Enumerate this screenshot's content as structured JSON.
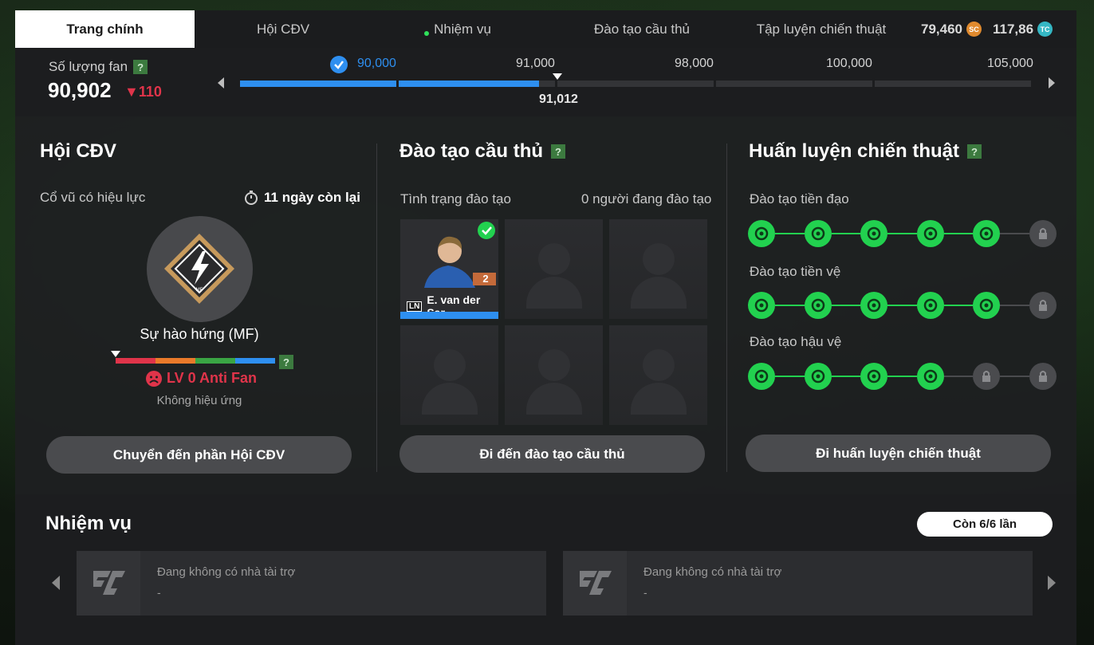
{
  "tabs": [
    {
      "label": "Trang chính",
      "active": true
    },
    {
      "label": "Hội CĐV",
      "active": false
    },
    {
      "label": "Nhiệm vụ",
      "active": false,
      "notification": true
    },
    {
      "label": "Đào tạo cầu thủ",
      "active": false
    },
    {
      "label": "Tập luyện chiến thuật",
      "active": false
    }
  ],
  "currency": {
    "sc_value": "79,460",
    "sc_icon": "SC",
    "tc_value": "117,86",
    "tc_icon": "TC"
  },
  "fans": {
    "label": "Số lượng fan",
    "help": "?",
    "count": "90,902",
    "delta": "▼110",
    "current_marker": "91,012",
    "milestones": [
      "90,000",
      "91,000",
      "98,000",
      "100,000",
      "105,000"
    ],
    "progress_segments_filled": 2,
    "progress_fraction_in_segment": 0.9
  },
  "supporters": {
    "title": "Hội CĐV",
    "effect_label": "Cổ vũ có hiệu lực",
    "time_left": "11 ngày còn lại",
    "badge_text": "MF",
    "cheer_name": "Sự hào hứng (MF)",
    "level": "LV 0 Anti Fan",
    "level_sub": "Không hiệu ứng",
    "help": "?",
    "button": "Chuyển đến phần Hội CĐV",
    "level_colors": [
      "#e0344a",
      "#ea7a2a",
      "#3aa544",
      "#2e8ff0"
    ]
  },
  "training": {
    "title": "Đào tạo cầu thủ",
    "help": "?",
    "status_label": "Tình trạng đào tạo",
    "status_count": "0 người đang đào tạo",
    "player_position": "LN",
    "player_name": "E. van der Sar",
    "player_level": "2",
    "button": "Đi đến đào tạo cầu thủ"
  },
  "tactics": {
    "title": "Huấn luyện chiến thuật",
    "help": "?",
    "rows": [
      {
        "label": "Đào tạo tiền đạo",
        "unlocked": 5,
        "total": 6
      },
      {
        "label": "Đào tạo tiền vệ",
        "unlocked": 5,
        "total": 6
      },
      {
        "label": "Đào tạo hậu vệ",
        "unlocked": 4,
        "total": 6
      }
    ],
    "button": "Đi huấn luyện chiến thuật"
  },
  "missions": {
    "title": "Nhiệm vụ",
    "remaining": "Còn 6/6 lần",
    "cards": [
      {
        "title": "Đang không có nhà tài trợ",
        "sub": "-"
      },
      {
        "title": "Đang không có nhà tài trợ",
        "sub": "-"
      }
    ]
  }
}
